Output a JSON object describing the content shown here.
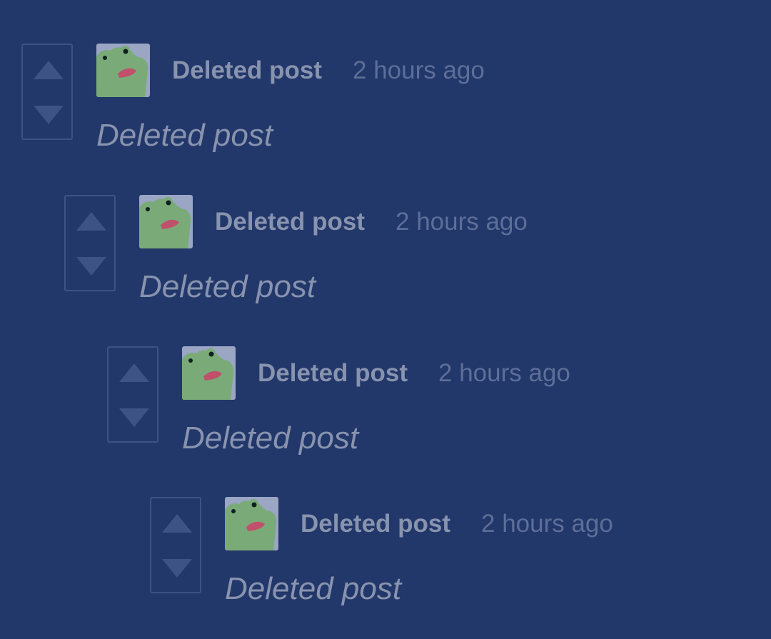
{
  "comments": [
    {
      "author": "Deleted post",
      "time": "2 hours ago",
      "body": "Deleted post"
    },
    {
      "author": "Deleted post",
      "time": "2 hours ago",
      "body": "Deleted post"
    },
    {
      "author": "Deleted post",
      "time": "2 hours ago",
      "body": "Deleted post"
    },
    {
      "author": "Deleted post",
      "time": "2 hours ago",
      "body": "Deleted post"
    }
  ],
  "icons": {
    "upvote": "upvote-arrow-icon",
    "downvote": "downvote-arrow-icon",
    "avatar": "frog-avatar"
  },
  "colors": {
    "background": "#22376a",
    "vote_border": "#3d5386",
    "vote_arrow": "#3d5386",
    "author_text": "#8893ae",
    "timestamp_text": "#5d6f98",
    "body_text": "#8893ae",
    "avatar_frog": "#7aaa78",
    "avatar_bg": "#9aa6c4",
    "avatar_mouth": "#c0506c"
  }
}
